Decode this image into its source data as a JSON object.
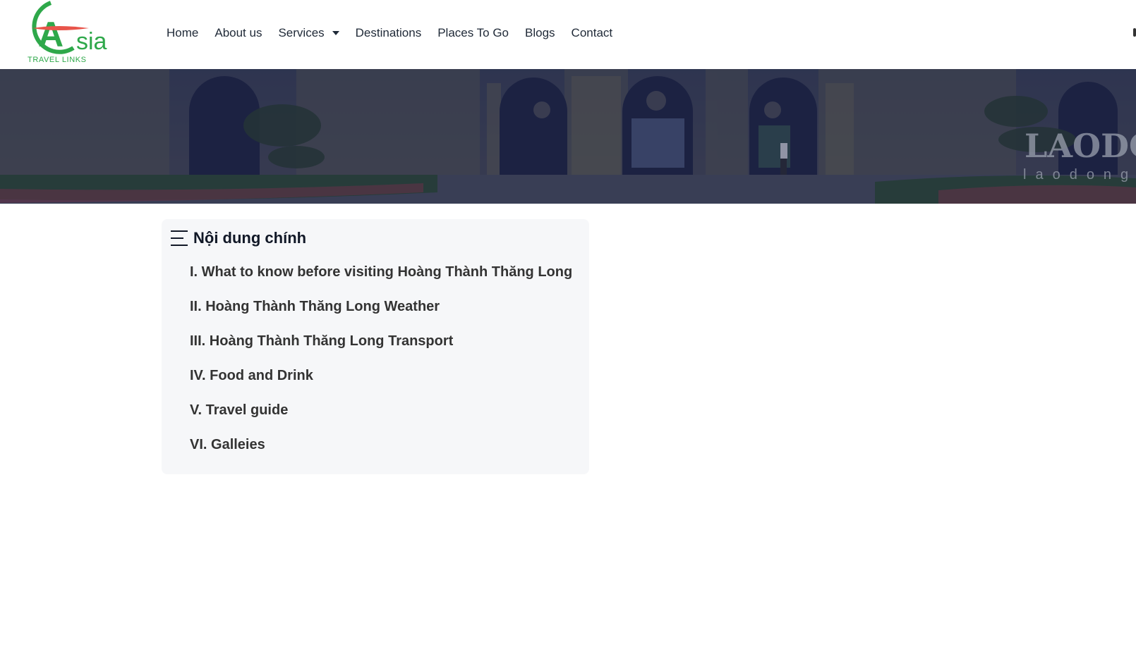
{
  "logo": {
    "letter": "A",
    "text": "sia",
    "tagline": "TRAVEL LINKS",
    "colors": {
      "green": "#2ea84a",
      "red": "#e8544a"
    }
  },
  "nav": {
    "items": [
      "Home",
      "About us",
      "Services",
      "Destinations",
      "Places To Go",
      "Blogs",
      "Contact"
    ],
    "dropdown_item": "Services"
  },
  "banner": {
    "watermark": "LAODO",
    "watermark_sub": "laodong"
  },
  "toc": {
    "icon": "menu-lines-icon",
    "title": "Nội dung chính",
    "items": [
      "I. What to know before visiting Hoàng Thành Thăng Long",
      "II. Hoàng Thành Thăng Long Weather",
      "III. Hoàng Thành Thăng Long Transport",
      "IV. Food and Drink",
      "V. Travel guide",
      "VI. Galleies"
    ]
  }
}
